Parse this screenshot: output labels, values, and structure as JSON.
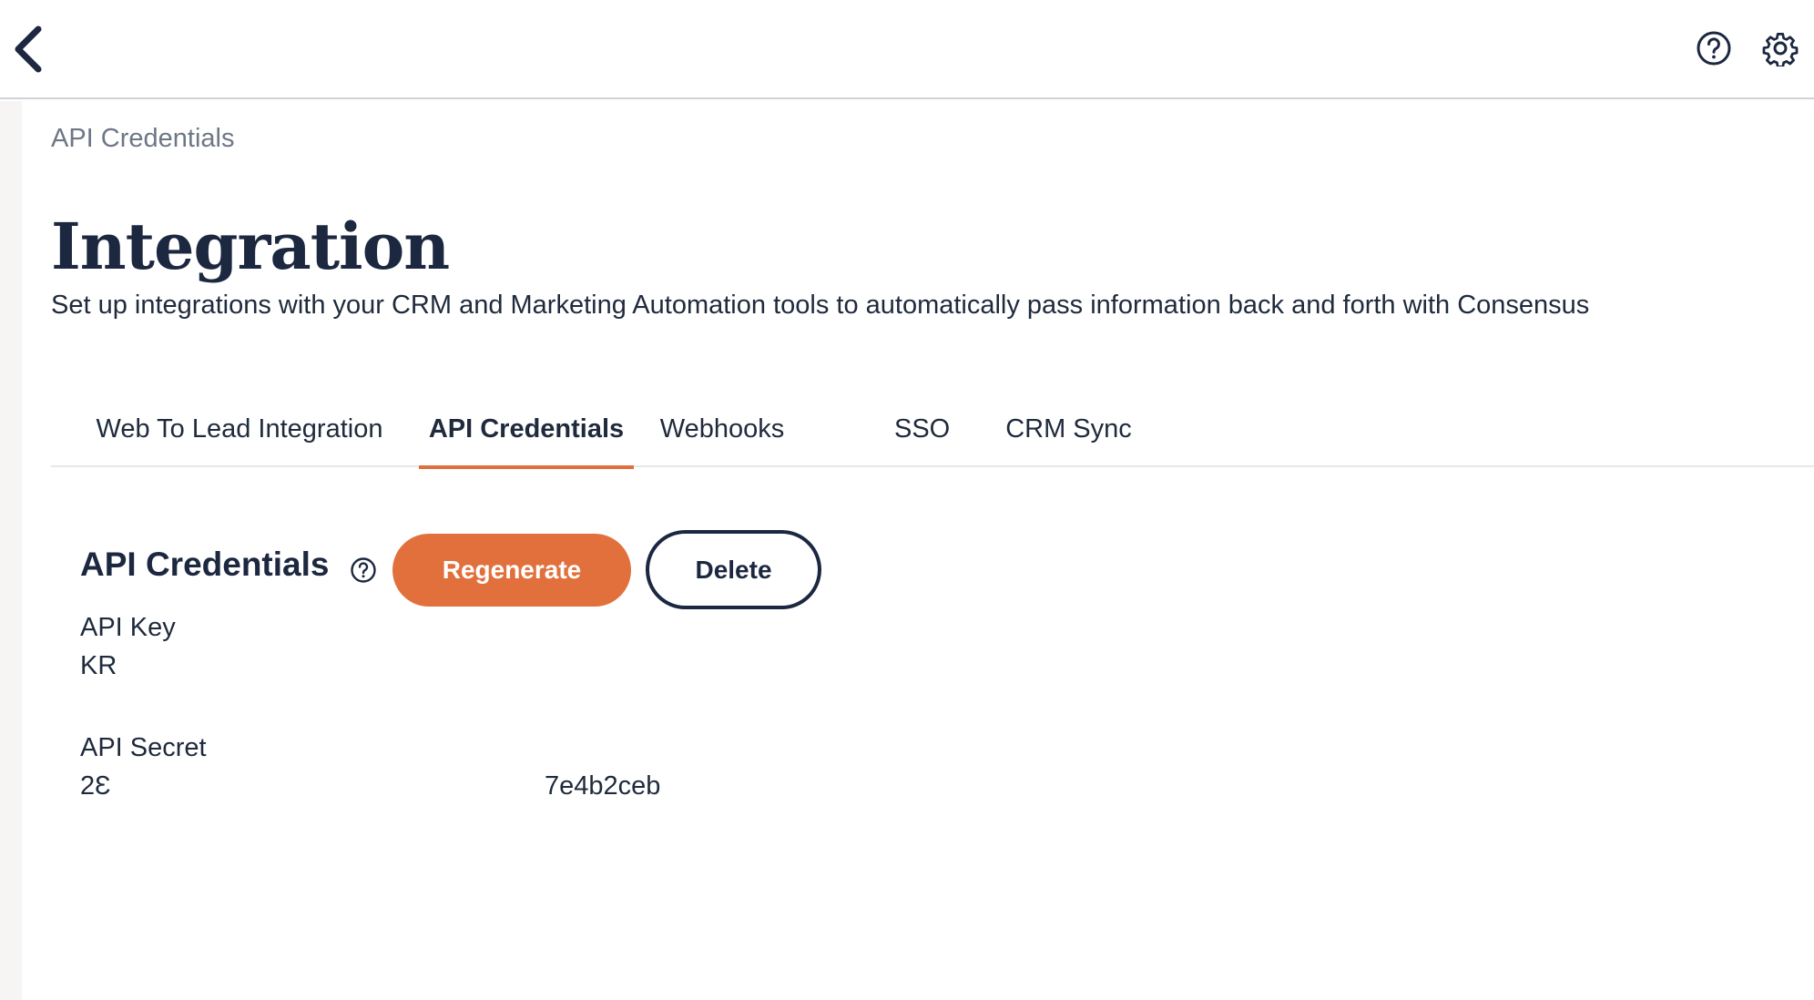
{
  "header": {
    "back_icon": "chevron-left-icon",
    "help_icon": "question-circle-icon",
    "settings_icon": "gear-icon"
  },
  "breadcrumb": "API Credentials",
  "page": {
    "title": "Integration",
    "subtitle": "Set up integrations with your CRM and Marketing Automation tools to automatically pass information back and forth with Consensus"
  },
  "tabs": [
    {
      "label": "Web To Lead Integration",
      "active": false
    },
    {
      "label": "API Credentials",
      "active": true
    },
    {
      "label": "Webhooks",
      "active": false
    },
    {
      "label": "SSO",
      "active": false
    },
    {
      "label": "CRM Sync",
      "active": false
    }
  ],
  "section": {
    "title": "API Credentials",
    "regenerate_label": "Regenerate",
    "delete_label": "Delete"
  },
  "fields": {
    "api_key_label": "API Key",
    "api_key_value": "KR",
    "api_secret_label": "API Secret",
    "api_secret_value_start": "2Ɛ",
    "api_secret_value_end": "7e4b2ceb"
  },
  "colors": {
    "accent": "#e2703c",
    "text_dark": "#1c2740",
    "muted": "#6d7785"
  }
}
